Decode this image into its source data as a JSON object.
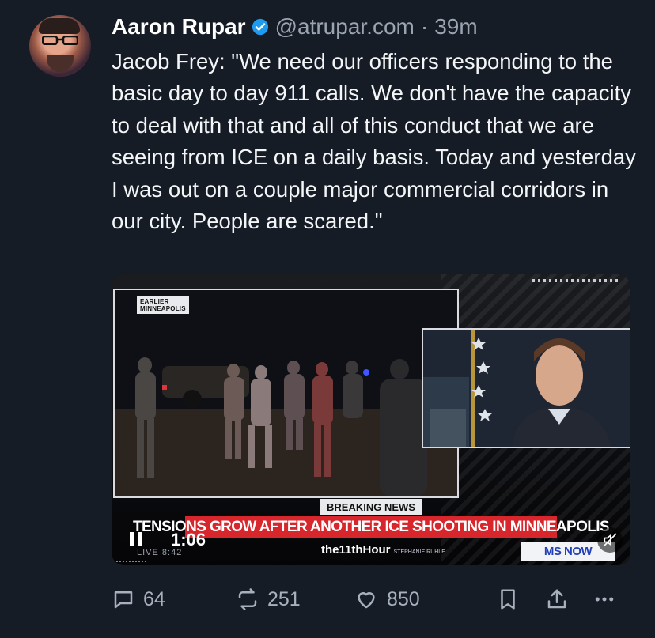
{
  "post": {
    "author_name": "Aaron Rupar",
    "handle": "@atrupar.com",
    "separator": "·",
    "time": "39m",
    "text": "Jacob Frey: \"We need our officers responding to the basic day to day 911 calls. We don't have the capacity to deal with that and all of this conduct that we are seeing from ICE on a daily basis. Today and yesterday I was out on a couple major commercial corridors in our city. People are scared.\""
  },
  "video": {
    "location_tag_line1": "EARLIER",
    "location_tag_line2": "MINNEAPOLIS",
    "breaking_label": "BREAKING NEWS",
    "headline": "TENSIONS GROW AFTER ANOTHER ICE SHOOTING IN MINNEAPOLIS",
    "show_name": "the11thHour",
    "show_host": "STEPHANIE RUHLE",
    "network": "MS NOW",
    "live_label": "LIVE",
    "live_time": "8:42",
    "timer": "1:06"
  },
  "actions": {
    "replies": "64",
    "reposts": "251",
    "likes": "850"
  },
  "colors": {
    "background": "#161c26",
    "verified": "#1d9bf0",
    "muted_text": "#9aa4b2",
    "breaking_red": "#d7262c"
  },
  "icons": [
    "verified-icon",
    "pause-icon",
    "mute-icon",
    "reply-icon",
    "repost-icon",
    "like-icon",
    "bookmark-icon",
    "share-icon",
    "more-icon"
  ]
}
